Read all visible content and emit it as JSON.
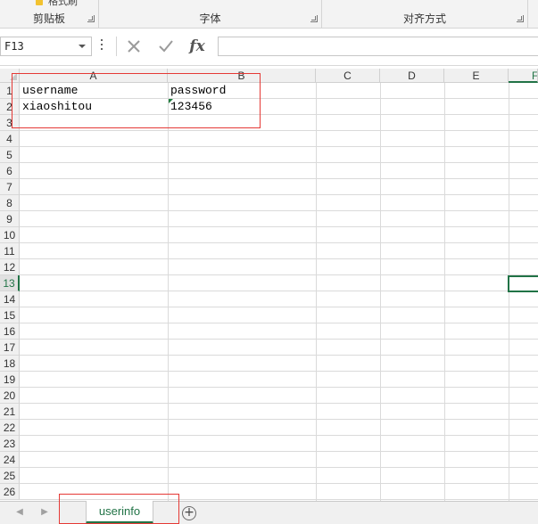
{
  "ribbon": {
    "partial_label": "格式刷",
    "groups": [
      {
        "label": "剪贴板"
      },
      {
        "label": "字体"
      },
      {
        "label": "对齐方式"
      }
    ]
  },
  "formula_bar": {
    "name_box": "F13",
    "cancel_icon": "close-icon",
    "enter_icon": "check-icon",
    "fx_label": "fx",
    "formula_value": ""
  },
  "columns": [
    "A",
    "B",
    "C",
    "D",
    "E",
    "F"
  ],
  "rows": [
    "1",
    "2",
    "3",
    "4",
    "5",
    "6",
    "7",
    "8",
    "9",
    "10",
    "11",
    "12",
    "13",
    "14",
    "15",
    "16",
    "17",
    "18",
    "19",
    "20",
    "21",
    "22",
    "23",
    "24",
    "25",
    "26"
  ],
  "cells": [
    {
      "ref": "A1",
      "value": "username"
    },
    {
      "ref": "B1",
      "value": "password"
    },
    {
      "ref": "A2",
      "value": "xiaoshitou"
    },
    {
      "ref": "B2",
      "value": "123456"
    }
  ],
  "selected_cell": "F13",
  "sheets": [
    {
      "name": "userinfo",
      "active": true
    }
  ],
  "colors": {
    "accent": "#217346",
    "highlight": "#e53935"
  }
}
